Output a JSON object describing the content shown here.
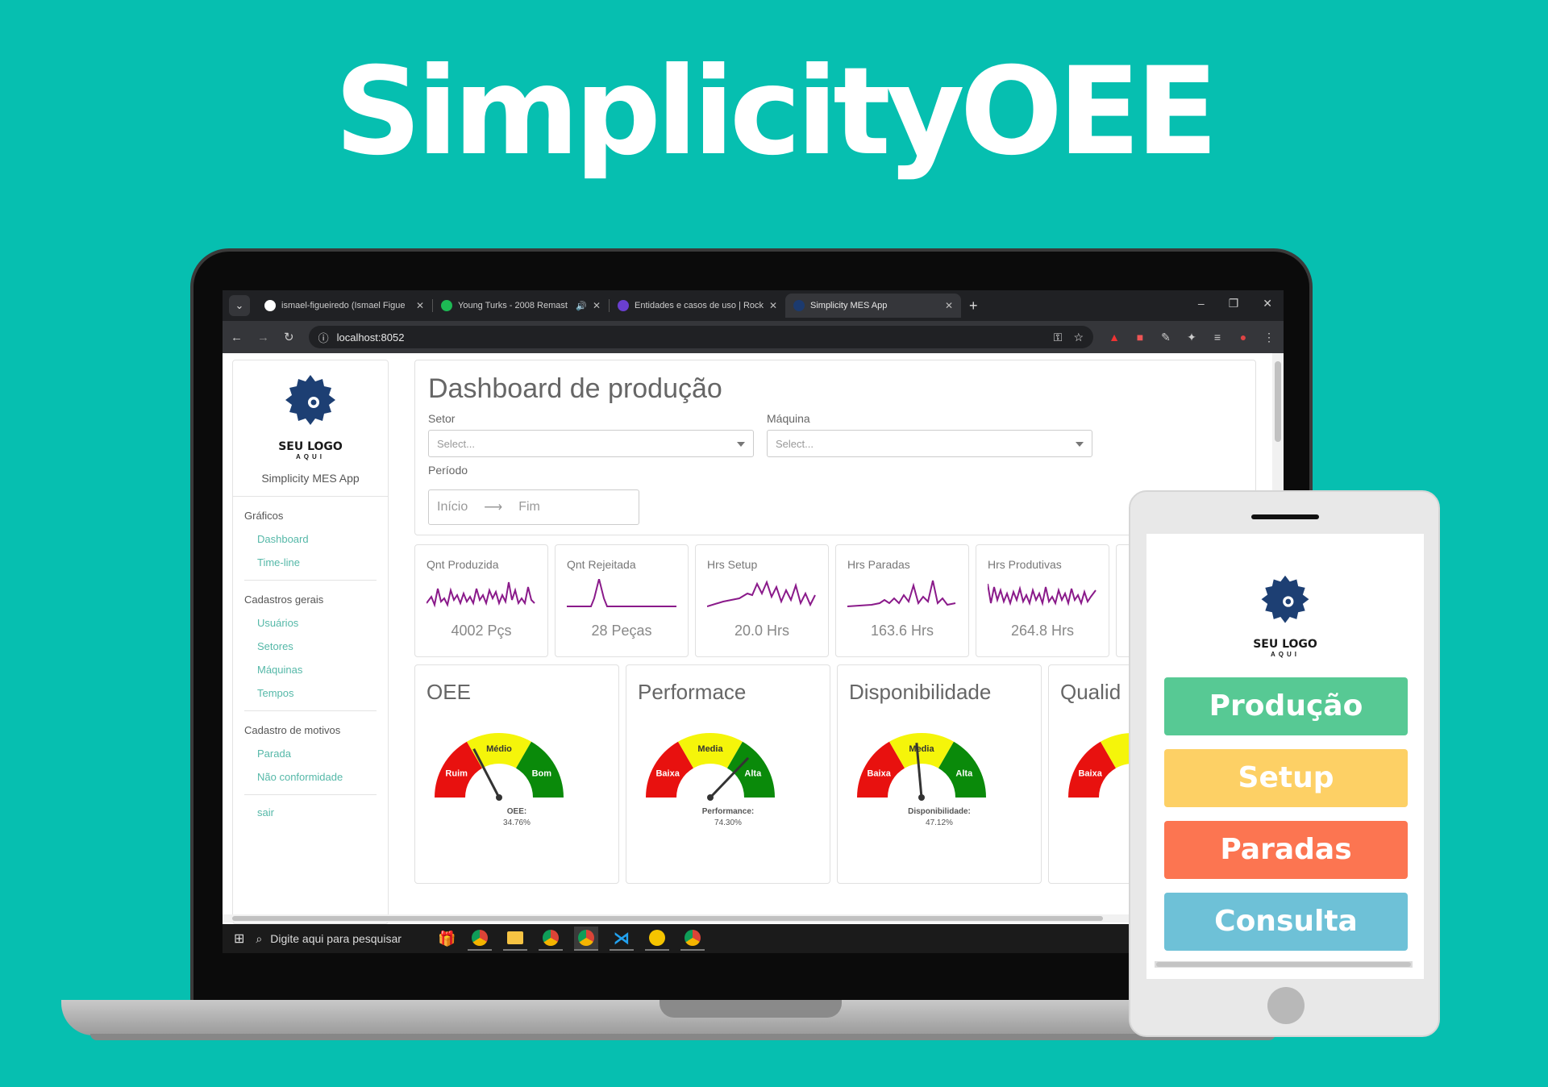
{
  "hero": {
    "title": "SimplicityOEE"
  },
  "browser": {
    "tabs": [
      {
        "label": "ismael-figueiredo (Ismael Figue",
        "favicon_color": "#ffffff",
        "icon": "github-icon"
      },
      {
        "label": "Young Turks - 2008 Remast",
        "favicon_color": "#1db954",
        "icon": "spotify-icon",
        "audio": "🔊"
      },
      {
        "label": "Entidades e casos de uso | Rock",
        "favicon_color": "#6a3fd0",
        "icon": "rocket-icon"
      },
      {
        "label": "Simplicity MES App",
        "favicon_color": "#1c3a6e",
        "icon": "app-icon",
        "active": true
      }
    ],
    "new_tab": "+",
    "close_glyph": "✕",
    "url": "localhost:8052"
  },
  "sidebar": {
    "logo_text": "SEU LOGO",
    "logo_sub": "AQUI",
    "app_name": "Simplicity MES App",
    "sections": [
      {
        "title": "Gráficos",
        "items": [
          "Dashboard",
          "Time-line"
        ]
      },
      {
        "title": "Cadastros gerais",
        "items": [
          "Usuários",
          "Setores",
          "Máquinas",
          "Tempos"
        ]
      },
      {
        "title": "Cadastro de motivos",
        "items": [
          "Parada",
          "Não conformidade"
        ]
      }
    ],
    "logout": "sair"
  },
  "filters": {
    "title": "Dashboard de produção",
    "setor_label": "Setor",
    "setor_placeholder": "Select...",
    "maquina_label": "Máquina",
    "maquina_placeholder": "Select...",
    "periodo_label": "Período",
    "inicio": "Início",
    "arrow": "⟶",
    "fim": "Fim"
  },
  "kpis": [
    {
      "title": "Qnt Produzida",
      "value": "4002 Pçs"
    },
    {
      "title": "Qnt Rejeitada",
      "value": "28 Peças"
    },
    {
      "title": "Hrs Setup",
      "value": "20.0 Hrs"
    },
    {
      "title": "Hrs Paradas",
      "value": "163.6 Hrs"
    },
    {
      "title": "Hrs Produtivas",
      "value": "264.8 Hrs"
    }
  ],
  "chart_data": [
    {
      "type": "gauge",
      "title": "OEE",
      "bands": [
        "Ruim",
        "Médio",
        "Bom"
      ],
      "band_colors": [
        "#e8110f",
        "#f5f50a",
        "#0a8a0a"
      ],
      "value_label": "OEE:",
      "value_text": "34.76%",
      "value": 34.76,
      "range": [
        0,
        100
      ]
    },
    {
      "type": "gauge",
      "title": "Performace",
      "bands": [
        "Baixa",
        "Media",
        "Alta"
      ],
      "band_colors": [
        "#e8110f",
        "#f5f50a",
        "#0a8a0a"
      ],
      "value_label": "Performance:",
      "value_text": "74.30%",
      "value": 74.3,
      "range": [
        0,
        100
      ]
    },
    {
      "type": "gauge",
      "title": "Disponibilidade",
      "bands": [
        "Baixa",
        "Media",
        "Alta"
      ],
      "band_colors": [
        "#e8110f",
        "#f5f50a",
        "#0a8a0a"
      ],
      "value_label": "Disponibilidade:",
      "value_text": "47.12%",
      "value": 47.12,
      "range": [
        0,
        100
      ]
    },
    {
      "type": "gauge",
      "title": "Qualid",
      "bands": [
        "Baixa"
      ],
      "band_colors": [
        "#e8110f",
        "#f5f50a",
        "#0a8a0a"
      ],
      "value_label": "",
      "value_text": "",
      "value": null,
      "range": [
        0,
        100
      ]
    }
  ],
  "taskbar": {
    "search_placeholder": "Digite aqui para pesquisar"
  },
  "tablet": {
    "logo_text": "SEU LOGO",
    "logo_sub": "AQUI",
    "buttons": [
      {
        "label": "Produção",
        "color": "#57c994"
      },
      {
        "label": "Setup",
        "color": "#fdd065"
      },
      {
        "label": "Paradas",
        "color": "#fc7551"
      },
      {
        "label": "Consulta",
        "color": "#6ec1d7"
      }
    ]
  },
  "colors": {
    "background": "#06bfb0",
    "link": "#55b8a8",
    "sparkline": "#8a1a8a"
  }
}
